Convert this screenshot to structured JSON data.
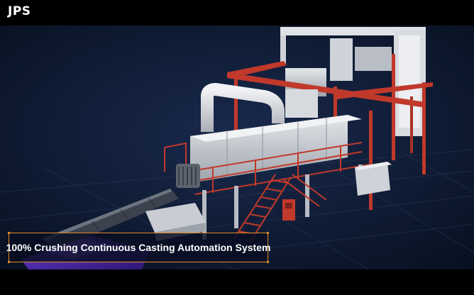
{
  "brand": {
    "logo_text": "JPS"
  },
  "caption": {
    "text": "100% Crushing Continuous Casting Automation System",
    "border_color": "#e08a2a"
  },
  "scene": {
    "description_icon": "industrial-machine-render",
    "background_color": "#0b1630",
    "frame_color": "#c0392b"
  }
}
